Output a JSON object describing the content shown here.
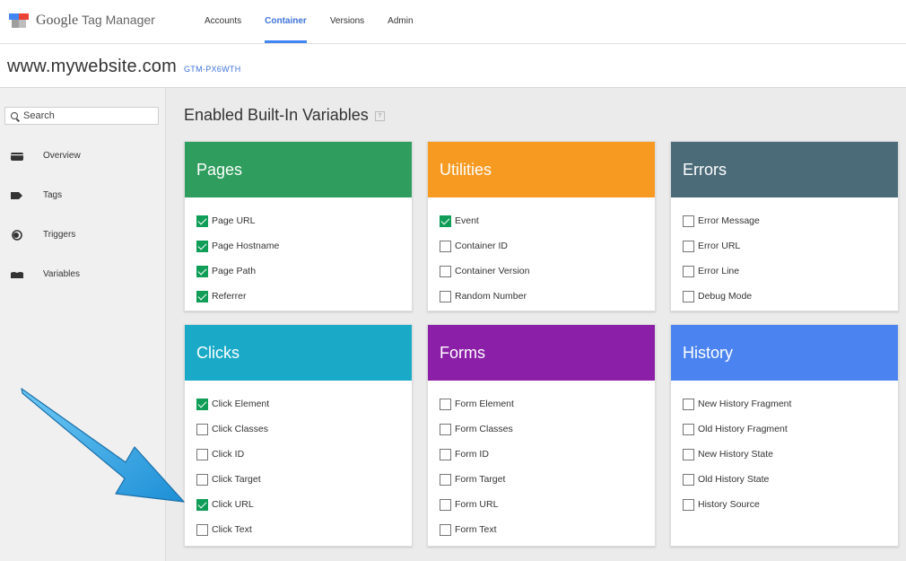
{
  "app": {
    "brand": "Google",
    "product": "Tag Manager"
  },
  "nav": [
    {
      "label": "Accounts",
      "active": false
    },
    {
      "label": "Container",
      "active": true
    },
    {
      "label": "Versions",
      "active": false
    },
    {
      "label": "Admin",
      "active": false
    }
  ],
  "site": {
    "name": "www.mywebsite.com",
    "container_id": "GTM-PX6WTH"
  },
  "sidebar": {
    "search_label": "Search",
    "items": [
      {
        "label": "Overview",
        "icon": "overview-icon"
      },
      {
        "label": "Tags",
        "icon": "tag-icon"
      },
      {
        "label": "Triggers",
        "icon": "trigger-icon"
      },
      {
        "label": "Variables",
        "icon": "variables-icon"
      }
    ]
  },
  "main": {
    "title": "Enabled Built-In Variables",
    "help": "?"
  },
  "cards": [
    {
      "title": "Pages",
      "color": "#2f9d5d",
      "items": [
        {
          "label": "Page URL",
          "checked": true
        },
        {
          "label": "Page Hostname",
          "checked": true
        },
        {
          "label": "Page Path",
          "checked": true
        },
        {
          "label": "Referrer",
          "checked": true
        }
      ]
    },
    {
      "title": "Utilities",
      "color": "#f79a22",
      "items": [
        {
          "label": "Event",
          "checked": true
        },
        {
          "label": "Container ID",
          "checked": false
        },
        {
          "label": "Container Version",
          "checked": false
        },
        {
          "label": "Random Number",
          "checked": false
        }
      ]
    },
    {
      "title": "Errors",
      "color": "#4b6b79",
      "items": [
        {
          "label": "Error Message",
          "checked": false
        },
        {
          "label": "Error URL",
          "checked": false
        },
        {
          "label": "Error Line",
          "checked": false
        },
        {
          "label": "Debug Mode",
          "checked": false
        }
      ]
    },
    {
      "title": "Clicks",
      "color": "#1aaac8",
      "items": [
        {
          "label": "Click Element",
          "checked": true
        },
        {
          "label": "Click Classes",
          "checked": false
        },
        {
          "label": "Click ID",
          "checked": false
        },
        {
          "label": "Click Target",
          "checked": false
        },
        {
          "label": "Click URL",
          "checked": true
        },
        {
          "label": "Click Text",
          "checked": false
        }
      ]
    },
    {
      "title": "Forms",
      "color": "#8b1fa8",
      "items": [
        {
          "label": "Form Element",
          "checked": false
        },
        {
          "label": "Form Classes",
          "checked": false
        },
        {
          "label": "Form ID",
          "checked": false
        },
        {
          "label": "Form Target",
          "checked": false
        },
        {
          "label": "Form URL",
          "checked": false
        },
        {
          "label": "Form Text",
          "checked": false
        }
      ]
    },
    {
      "title": "History",
      "color": "#4b84f0",
      "items": [
        {
          "label": "New History Fragment",
          "checked": false
        },
        {
          "label": "Old History Fragment",
          "checked": false
        },
        {
          "label": "New History State",
          "checked": false
        },
        {
          "label": "Old History State",
          "checked": false
        },
        {
          "label": "History Source",
          "checked": false
        }
      ]
    }
  ]
}
